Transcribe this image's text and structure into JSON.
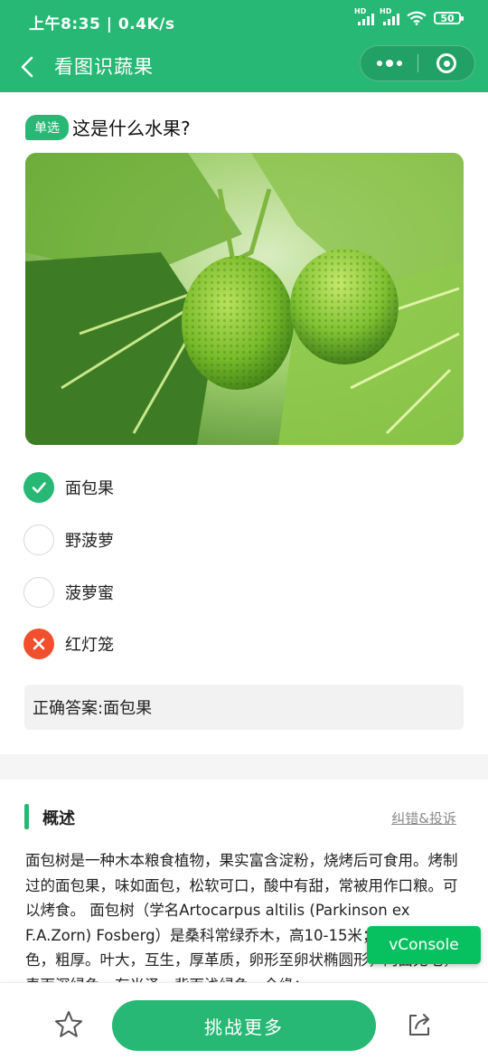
{
  "status": {
    "time_speed": "上午8:35 | 0.4K/s",
    "hd1": "HD",
    "hd2": "HD",
    "battery": "50"
  },
  "nav": {
    "title": "看图识蔬果"
  },
  "question": {
    "tag": "单选",
    "text": "这是什么水果?",
    "options": [
      {
        "label": "面包果",
        "state": "correct"
      },
      {
        "label": "野菠萝",
        "state": "none"
      },
      {
        "label": "菠萝蜜",
        "state": "none"
      },
      {
        "label": "红灯笼",
        "state": "wrong"
      }
    ],
    "answer_label": "正确答案:",
    "answer_value": "面包果"
  },
  "overview": {
    "title": "概述",
    "report_link": "纠错&投诉",
    "text": "面包树是一种木本粮食植物，果实富含淀粉，烧烤后可食用。烤制过的面包果，味如面包，松软可口，酸中有甜，常被用作口粮。可以烤食。 面包树（学名Artocarpus altilis (Parkinson ex F.A.Zorn) Fosberg）是桑科常绿乔木，高10-15米；树皮灰褐色，粗厚。叶大，互生，厚革质，卵形至卵状椭圆形，两面无毛，表面深绿色，有光泽，背面浅绿色，全缘；"
  },
  "vconsole": {
    "label": "vConsole"
  },
  "bottom": {
    "challenge_label": "挑战更多"
  },
  "colors": {
    "brand": "#26b874",
    "wrong": "#f0502e",
    "vconsole": "#07c160"
  }
}
